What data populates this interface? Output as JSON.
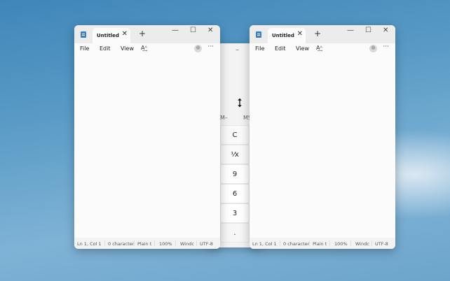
{
  "calculator": {
    "minimize_glyph": "–",
    "memory_left": "M–",
    "memory_right": "MS",
    "keys": [
      "C",
      "⅟x",
      "9",
      "6",
      "3",
      "."
    ]
  },
  "notepad_left": {
    "tab_title": "Untitled",
    "tab_close": "✕",
    "new_tab": "+",
    "minimize": "—",
    "maximize": "☐",
    "close": "✕",
    "menu": {
      "file": "File",
      "edit": "Edit",
      "view": "View",
      "format_glyph": "A͢ᴬ",
      "more": "···"
    },
    "status": {
      "position": "Ln 1, Col 1",
      "characters": "0 character",
      "type": "Plain t",
      "zoom": "100%",
      "eol": "Windc",
      "encoding": "UTF-8"
    }
  },
  "notepad_right": {
    "tab_title": "Untitled",
    "tab_close": "✕",
    "new_tab": "+",
    "minimize": "—",
    "maximize": "☐",
    "close": "✕",
    "menu": {
      "file": "File",
      "edit": "Edit",
      "view": "View",
      "format_glyph": "A͢ᴬ",
      "more": "···"
    },
    "status": {
      "position": "Ln 1, Col 1",
      "characters": "0 character",
      "type": "Plain t",
      "zoom": "100%",
      "eol": "Windc",
      "encoding": "UTF-8"
    }
  },
  "cursor": {
    "icon": "vertical-resize-cursor-icon"
  }
}
